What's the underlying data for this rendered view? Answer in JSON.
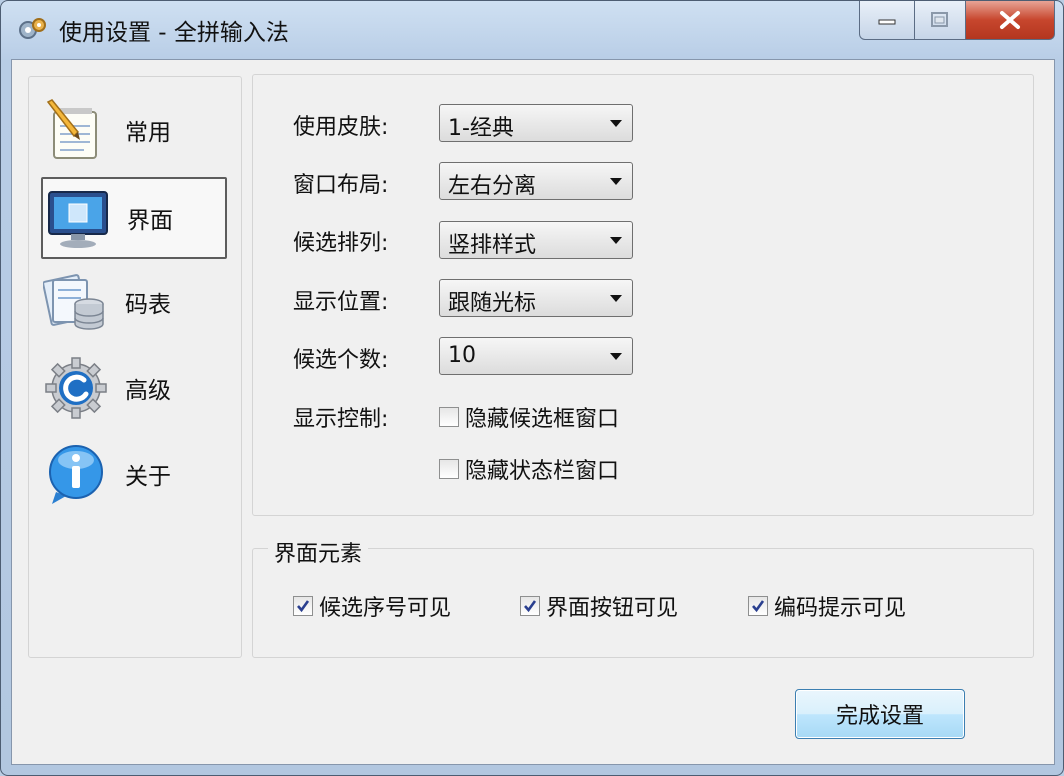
{
  "window": {
    "title": "使用设置 - 全拼输入法"
  },
  "nav": {
    "items": [
      {
        "label": "常用",
        "icon": "notepad-pencil-icon"
      },
      {
        "label": "界面",
        "icon": "monitor-icon",
        "selected": true
      },
      {
        "label": "码表",
        "icon": "database-icon"
      },
      {
        "label": "高级",
        "icon": "gear-icon"
      },
      {
        "label": "关于",
        "icon": "info-bubble-icon"
      }
    ]
  },
  "settings": {
    "skin": {
      "label": "使用皮肤:",
      "value": "1-经典"
    },
    "layout": {
      "label": "窗口布局:",
      "value": "左右分离"
    },
    "arrangement": {
      "label": "候选排列:",
      "value": "竖排样式"
    },
    "position": {
      "label": "显示位置:",
      "value": "跟随光标"
    },
    "count": {
      "label": "候选个数:",
      "value": "10"
    },
    "display_control": {
      "label": "显示控制:",
      "hide_candidate_window": {
        "label": "隐藏候选框窗口",
        "checked": false
      },
      "hide_status_window": {
        "label": "隐藏状态栏窗口",
        "checked": false
      }
    }
  },
  "ui_elements": {
    "title": "界面元素",
    "candidate_index_visible": {
      "label": "候选序号可见",
      "checked": true
    },
    "ui_buttons_visible": {
      "label": "界面按钮可见",
      "checked": true
    },
    "code_hint_visible": {
      "label": "编码提示可见",
      "checked": true
    }
  },
  "finish_button": "完成设置",
  "colors": {
    "close_button": "#c7462d",
    "checkmark": "#2a3f8f"
  }
}
